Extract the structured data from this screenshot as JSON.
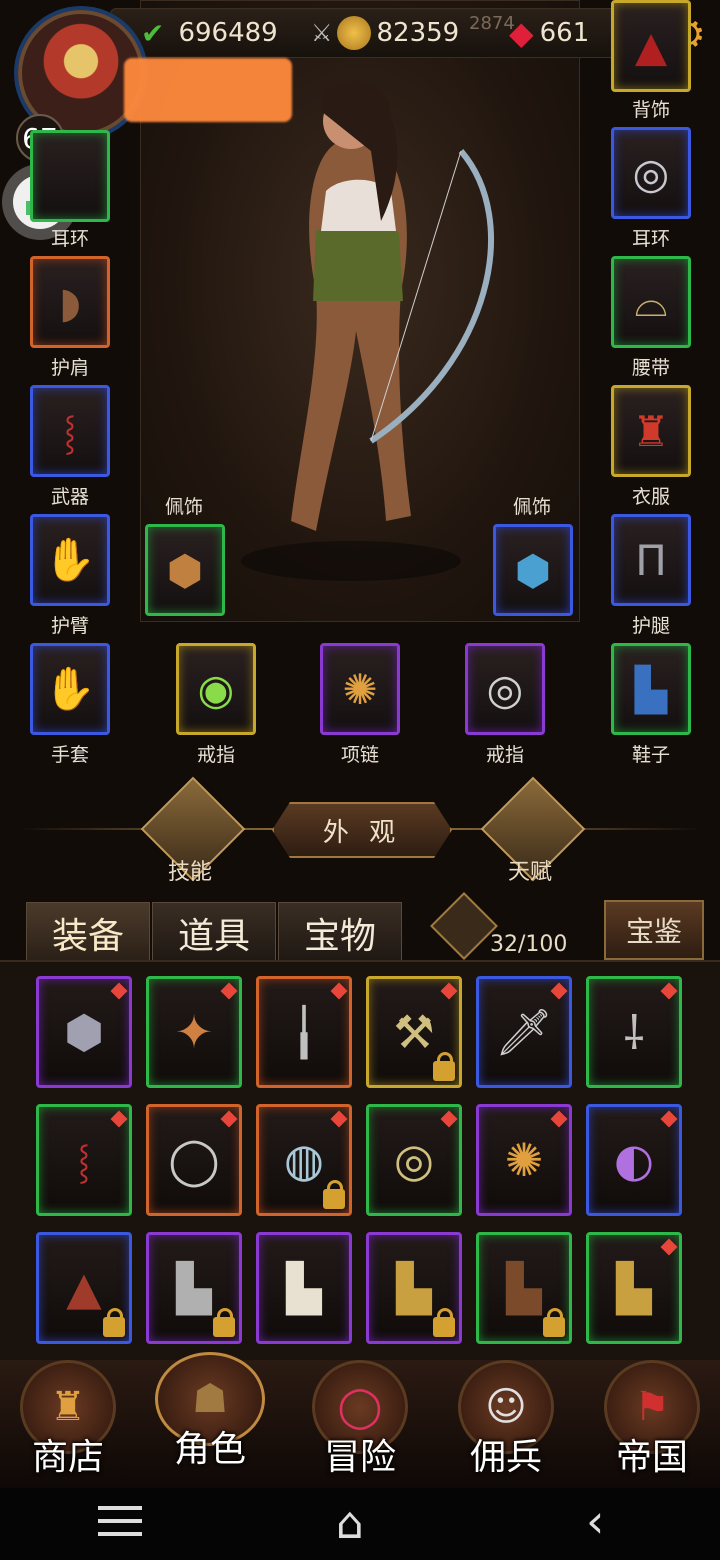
{
  "resources": {
    "exp": "696489",
    "gold": "82359",
    "faded": "2874",
    "gems": "661"
  },
  "player": {
    "level": "67"
  },
  "char_panel": {
    "accessory_left": "佩饰",
    "accessory_right": "佩饰"
  },
  "left_slots": [
    "耳环",
    "护肩",
    "武器",
    "护臂",
    "手套"
  ],
  "right_slots": [
    "背饰",
    "耳环",
    "腰带",
    "衣服",
    "护腿",
    "鞋子"
  ],
  "bottom_slots": [
    "戒指",
    "项链",
    "戒指"
  ],
  "menu": {
    "skills": "技能",
    "appearance": "外 观",
    "talent": "天赋"
  },
  "tabs": [
    "装备",
    "道具",
    "宝物"
  ],
  "inventory": {
    "count": "32/100",
    "codex": "宝鉴"
  },
  "nav": [
    "商店",
    "角色",
    "冒险",
    "佣兵",
    "帝国"
  ],
  "colors": {
    "green": "#2fb84a",
    "blue": "#3a58e0",
    "purple": "#8a3ad0",
    "yellow": "#c8a82a",
    "orange": "#d0642a"
  }
}
